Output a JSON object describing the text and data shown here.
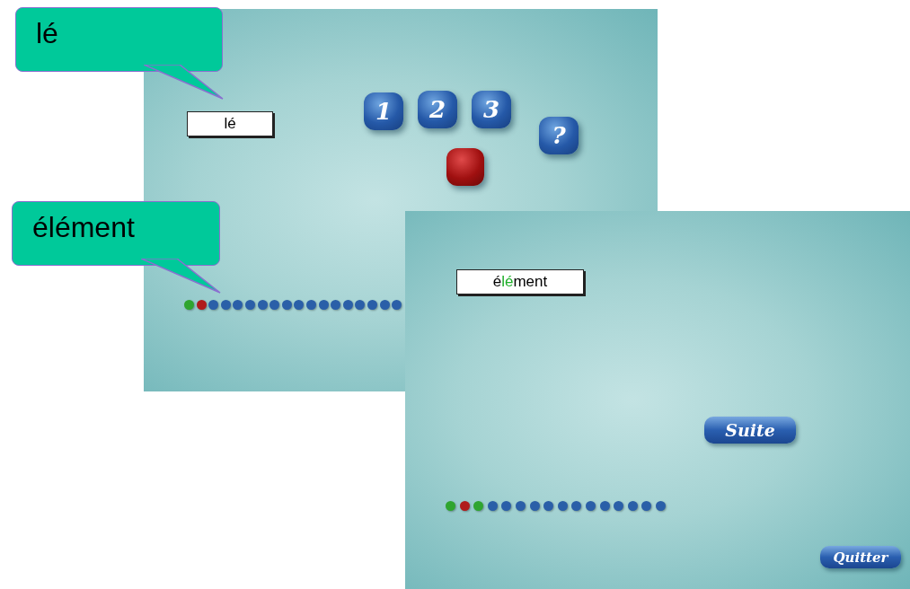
{
  "screens": [
    {
      "word_parts": [
        {
          "text": "lé",
          "highlight": false
        }
      ],
      "number_buttons": [
        "1",
        "2",
        "3"
      ],
      "help_button": "?",
      "progress": [
        {
          "color": "#2fa52f"
        },
        {
          "color": "#b01c1c"
        },
        {
          "color": "#2a5fa8"
        },
        {
          "color": "#2a5fa8"
        },
        {
          "color": "#2a5fa8"
        },
        {
          "color": "#2a5fa8"
        },
        {
          "color": "#2a5fa8"
        },
        {
          "color": "#2a5fa8"
        },
        {
          "color": "#2a5fa8"
        },
        {
          "color": "#2a5fa8"
        },
        {
          "color": "#2a5fa8"
        },
        {
          "color": "#2a5fa8"
        },
        {
          "color": "#2a5fa8"
        },
        {
          "color": "#2a5fa8"
        },
        {
          "color": "#2a5fa8"
        },
        {
          "color": "#2a5fa8"
        },
        {
          "color": "#2a5fa8"
        },
        {
          "color": "#2a5fa8"
        }
      ]
    },
    {
      "word_parts": [
        {
          "text": "é",
          "highlight": false
        },
        {
          "text": "lé",
          "highlight": true
        },
        {
          "text": "ment",
          "highlight": false
        }
      ],
      "next_button": "Suite",
      "quit_button": "Quitter",
      "progress": [
        {
          "color": "#2fa52f"
        },
        {
          "color": "#b01c1c"
        },
        {
          "color": "#2fa52f"
        },
        {
          "color": "#2a5fa8"
        },
        {
          "color": "#2a5fa8"
        },
        {
          "color": "#2a5fa8"
        },
        {
          "color": "#2a5fa8"
        },
        {
          "color": "#2a5fa8"
        },
        {
          "color": "#2a5fa8"
        },
        {
          "color": "#2a5fa8"
        },
        {
          "color": "#2a5fa8"
        },
        {
          "color": "#2a5fa8"
        },
        {
          "color": "#2a5fa8"
        },
        {
          "color": "#2a5fa8"
        },
        {
          "color": "#2a5fa8"
        },
        {
          "color": "#2a5fa8"
        }
      ]
    }
  ],
  "callouts": [
    "lé",
    "élément"
  ]
}
